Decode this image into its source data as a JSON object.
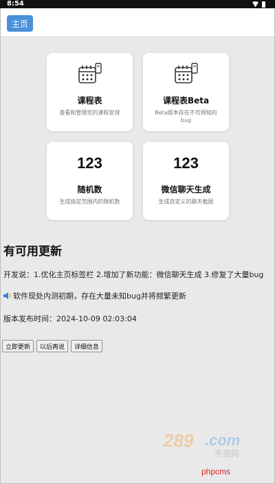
{
  "status_bar": {
    "time": "8:54"
  },
  "header": {
    "home_label": "主页"
  },
  "cards": [
    {
      "title": "课程表",
      "desc": "查看和管理您的课程安排",
      "icon": "calendar-icon"
    },
    {
      "title": "课程表Beta",
      "desc": "Beta版本存在不可预知的bug",
      "icon": "calendar-icon"
    },
    {
      "number": "123",
      "title": "随机数",
      "desc": "生成指定范围内的随机数"
    },
    {
      "number": "123",
      "title": "微信聊天生成",
      "desc": "生成自定义的聊天截图"
    }
  ],
  "update": {
    "title": "有可用更新",
    "dev_notes": "开发说：1.优化主页标签栏 2.增加了新功能：微信聊天生成 3.修复了大量bug",
    "warning": "软件现处内测初期，存在大量未知bug并将频繁更新",
    "release_time": "版本发布时间：2024-10-09 02:03:04",
    "buttons": {
      "update_now": "立即更新",
      "later": "以后再说",
      "details": "详细信息"
    }
  },
  "watermark": {
    "logo": "289.com 手游网",
    "text": "phpcms"
  },
  "colors": {
    "accent": "#4a90d9",
    "background": "#e9e9e9",
    "watermark": "#dd2222"
  }
}
